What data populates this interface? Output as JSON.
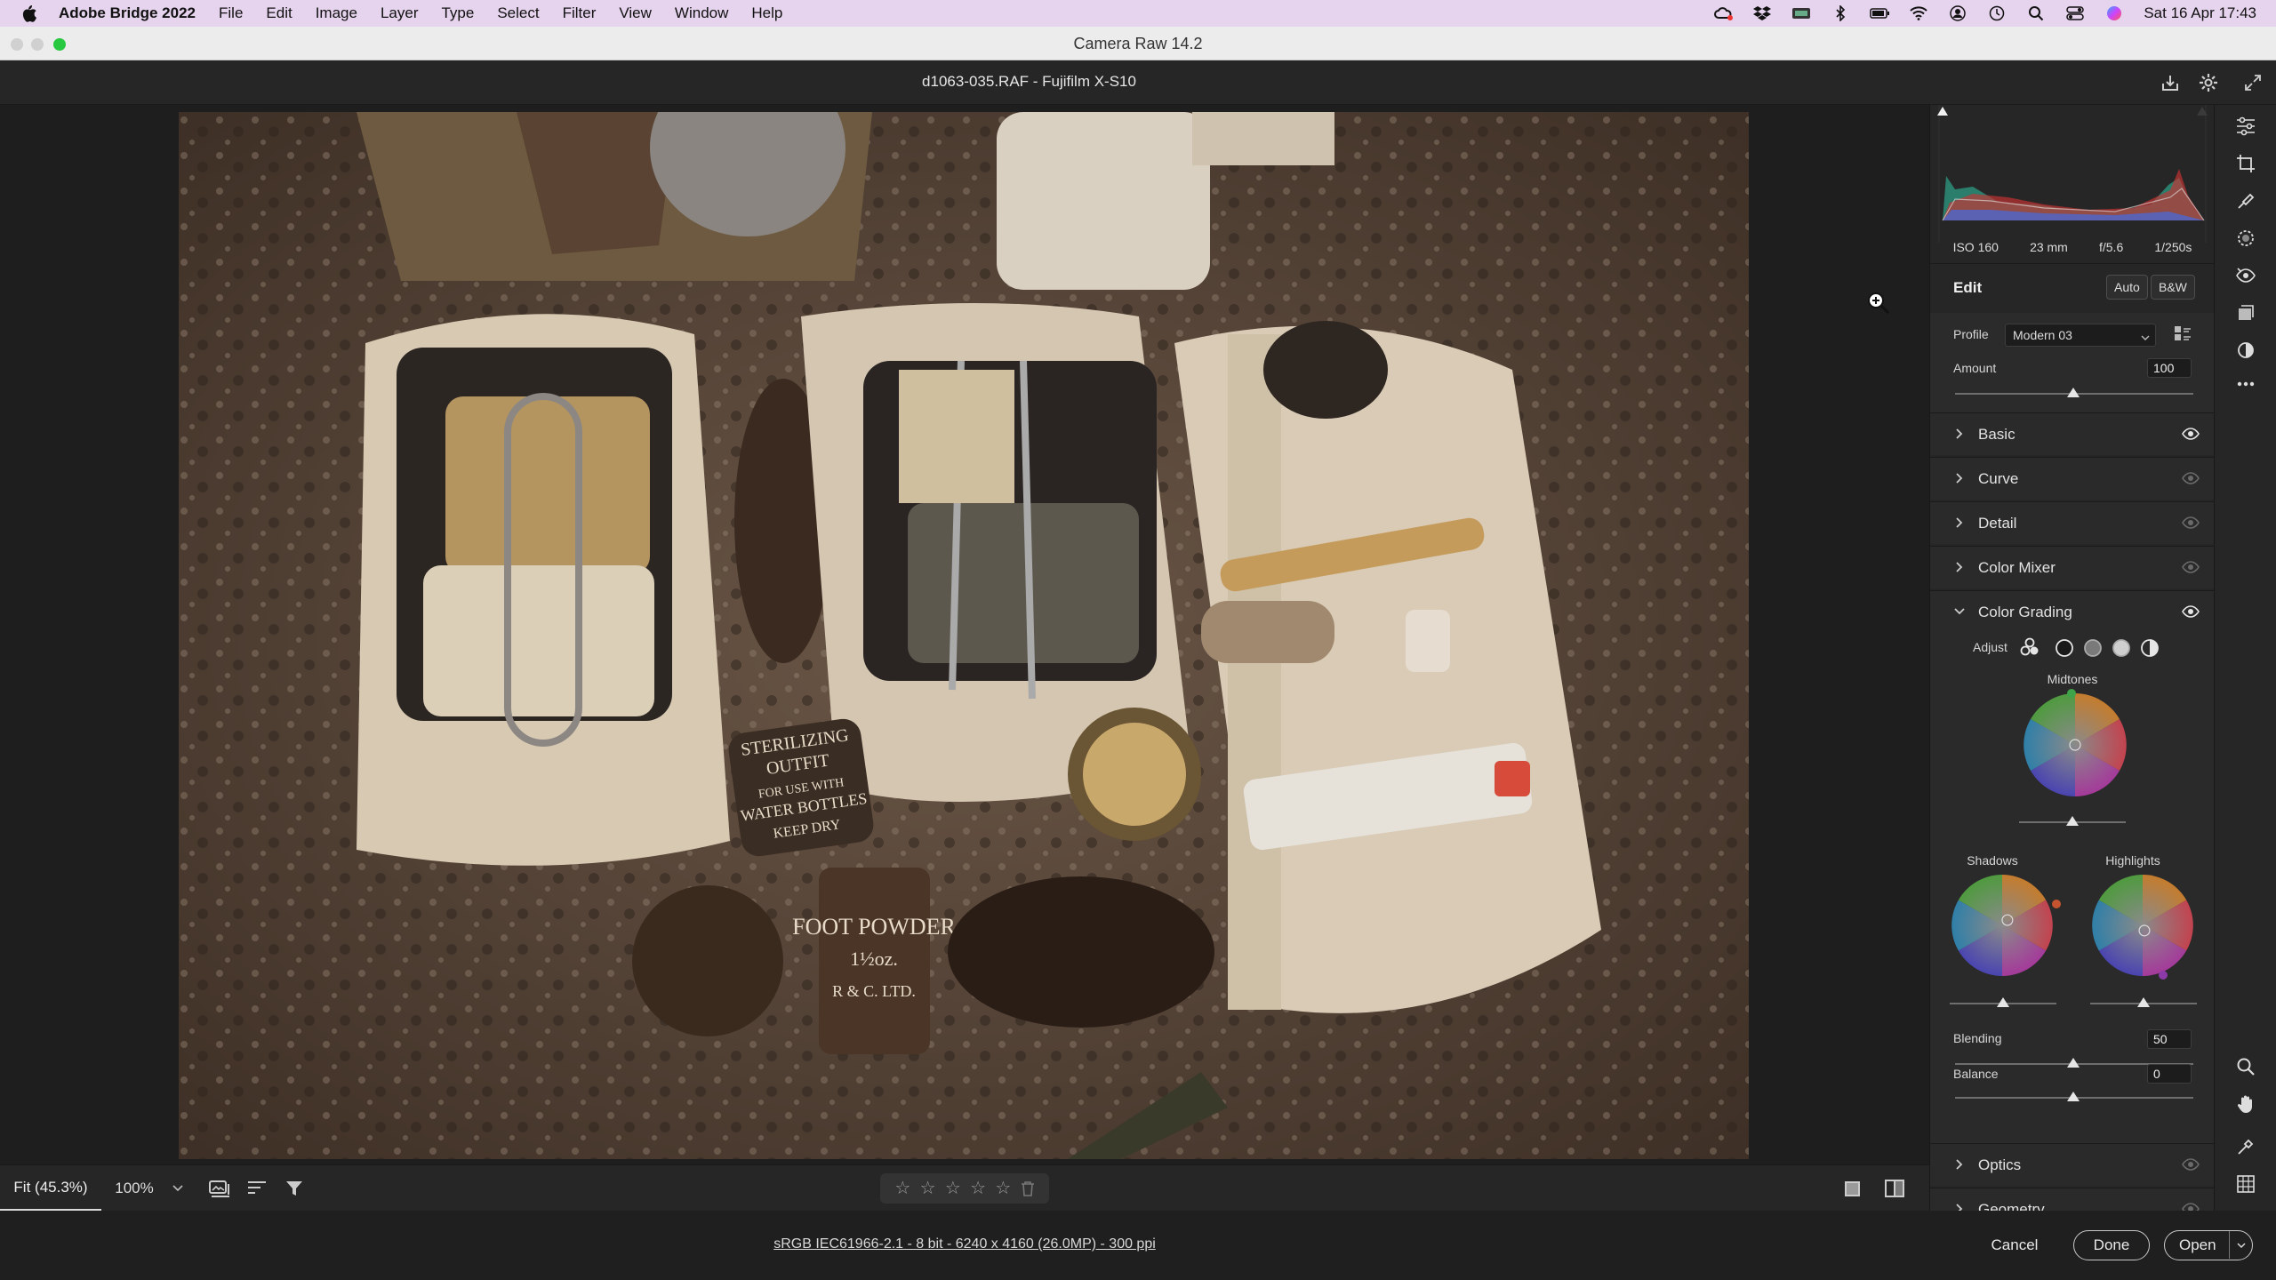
{
  "menubar": {
    "app_name": "Adobe Bridge 2022",
    "items": [
      "File",
      "Edit",
      "Image",
      "Layer",
      "Type",
      "Select",
      "Filter",
      "View",
      "Window",
      "Help"
    ],
    "clock": "Sat 16 Apr  17:43"
  },
  "window": {
    "title": "Camera Raw 14.2"
  },
  "file": {
    "name": "d1063-035.RAF  -  Fujifilm X-S10"
  },
  "exif": {
    "iso": "ISO 160",
    "focal": "23 mm",
    "aperture": "f/5.6",
    "shutter": "1/250s"
  },
  "edit": {
    "label": "Edit",
    "auto": "Auto",
    "bw": "B&W",
    "profile_label": "Profile",
    "profile_value": "Modern 03",
    "amount_label": "Amount",
    "amount_value": "100",
    "amount_level": 1.0
  },
  "sections": {
    "basic": "Basic",
    "curve": "Curve",
    "detail": "Detail",
    "color_mixer": "Color Mixer",
    "color_grading": "Color Grading",
    "optics": "Optics",
    "geometry": "Geometry"
  },
  "color_grading": {
    "adjust_label": "Adjust",
    "midtones": "Midtones",
    "shadows": "Shadows",
    "highlights": "Highlights",
    "blending_label": "Blending",
    "blending_value": "50",
    "balance_label": "Balance",
    "balance_value": "0"
  },
  "bottombar": {
    "fit": "Fit (45.3%)",
    "zoom": "100%",
    "stars": [
      "☆",
      "☆",
      "☆",
      "☆",
      "☆"
    ]
  },
  "footer": {
    "info": "sRGB IEC61966-2.1 - 8 bit - 6240 x 4160 (26.0MP) - 300 ppi",
    "cancel": "Cancel",
    "done": "Done",
    "open": "Open"
  },
  "colors": {
    "menubar_bg": "#e6d3ee",
    "panel_bg": "#262626",
    "canvas_bg": "#1e1e1e",
    "traffic_red": "#ff5f57",
    "traffic_yellow": "#febc2e",
    "traffic_green": "#28c840"
  },
  "icons": {
    "menubar": [
      "apple-logo-icon",
      "creative-cloud-icon",
      "dropbox-icon",
      "app-status-icon",
      "bluetooth-icon",
      "battery-icon",
      "wifi-icon",
      "user-icon",
      "time-machine-icon",
      "spotlight-icon",
      "control-center-icon",
      "siri-icon"
    ],
    "tools": [
      "edit-sliders-icon",
      "crop-icon",
      "healing-brush-icon",
      "masking-icon",
      "red-eye-icon",
      "snapshots-icon",
      "presets-icon",
      "more-icon",
      "zoom-icon",
      "hand-icon",
      "color-sampler-icon",
      "grid-icon"
    ]
  }
}
